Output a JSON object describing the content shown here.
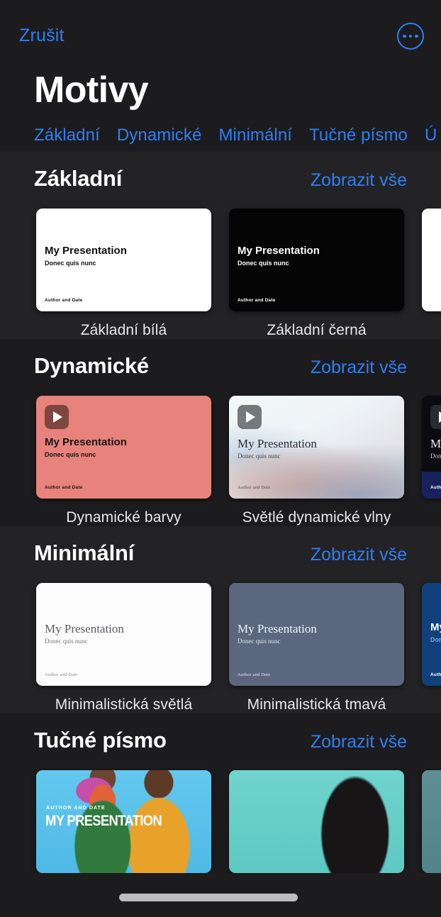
{
  "navbar": {
    "cancel_label": "Zrušit",
    "more_icon": "ellipsis-circle-icon",
    "accent_color": "#2f7ef5"
  },
  "page_title": "Motivy",
  "tabs": [
    {
      "label": "Základní"
    },
    {
      "label": "Dynamické"
    },
    {
      "label": "Minimální"
    },
    {
      "label": "Tučné písmo"
    },
    {
      "label": "Ú"
    }
  ],
  "slide_text": {
    "title": "My Presentation",
    "subtitle": "Donec quis nunc",
    "footer": "Author and Date"
  },
  "bold_slide_text": {
    "kicker": "AUTHOR AND DATE",
    "title": "MY PRESENTATION"
  },
  "see_all_label": "Zobrazit vše",
  "sections": [
    {
      "title": "Základní",
      "see_all": "Zobrazit vše",
      "cards": [
        {
          "label": "Základní bílá",
          "theme": "t-basic-white",
          "play": false
        },
        {
          "label": "Základní černá",
          "theme": "t-basic-black",
          "play": false
        },
        {
          "label": "",
          "theme": "t-basic-white",
          "play": false
        }
      ]
    },
    {
      "title": "Dynamické",
      "see_all": "Zobrazit vše",
      "cards": [
        {
          "label": "Dynamické barvy",
          "theme": "t-dyn-coral",
          "play": true
        },
        {
          "label": "Světlé dynamické vlny",
          "theme": "t-waves",
          "play": true
        },
        {
          "label": "",
          "theme": "t-dyn-dark",
          "play": true
        }
      ]
    },
    {
      "title": "Minimální",
      "see_all": "Zobrazit vše",
      "cards": [
        {
          "label": "Minimalistická světlá",
          "theme": "t-min-light",
          "play": false
        },
        {
          "label": "Minimalistická tmavá",
          "theme": "t-min-dark",
          "play": false
        },
        {
          "label": "",
          "theme": "t-min-navy",
          "play": false
        }
      ]
    },
    {
      "title": "Tučné písmo",
      "see_all": "Zobrazit vše",
      "cards": [
        {
          "label": "",
          "theme": "t-bold-1",
          "play": false
        },
        {
          "label": "",
          "theme": "t-bold-2",
          "play": false
        },
        {
          "label": "",
          "theme": "t-bold-3",
          "play": false
        }
      ]
    }
  ],
  "scroll_indicator": {
    "name": "horizontal-scroll-indicator"
  },
  "colors": {
    "page_background": "#1c1c1e",
    "section_band": "#232325",
    "accent_blue": "#2f7ef5",
    "label_text": "#e9e9ea"
  }
}
